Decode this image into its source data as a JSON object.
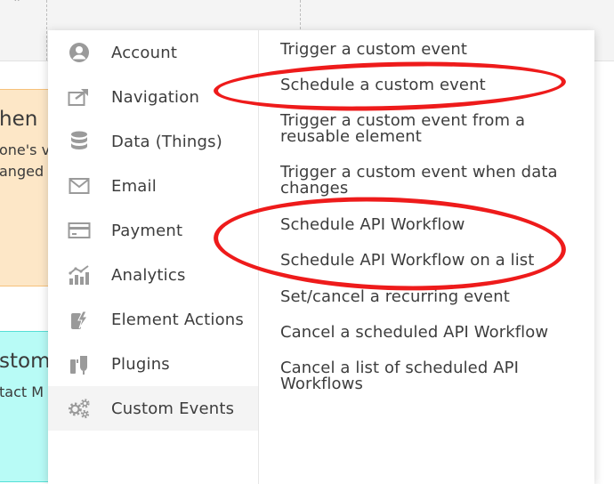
{
  "background_cards": {
    "orange": {
      "title": "hen",
      "lines": [
        "one's v",
        "anged"
      ]
    },
    "cyan": {
      "title": "stom",
      "lines": [
        "tact M"
      ]
    }
  },
  "menu": {
    "categories": [
      {
        "label": "Account",
        "icon": "account-icon"
      },
      {
        "label": "Navigation",
        "icon": "navigation-icon"
      },
      {
        "label": "Data (Things)",
        "icon": "database-icon"
      },
      {
        "label": "Email",
        "icon": "email-icon"
      },
      {
        "label": "Payment",
        "icon": "payment-icon"
      },
      {
        "label": "Analytics",
        "icon": "analytics-icon"
      },
      {
        "label": "Element Actions",
        "icon": "element-actions-icon"
      },
      {
        "label": "Plugins",
        "icon": "plugins-icon"
      },
      {
        "label": "Custom Events",
        "icon": "gears-icon",
        "selected": true
      }
    ],
    "actions": [
      {
        "text": "Trigger a custom event"
      },
      {
        "text": "Schedule a custom event",
        "annotated": true
      },
      {
        "text": "Trigger a custom event from a reusable element"
      },
      {
        "text": "Trigger a custom event when data changes"
      },
      {
        "text": "Schedule API Workflow",
        "annotated": true
      },
      {
        "text": "Schedule API Workflow on a list",
        "annotated": true
      },
      {
        "text": "Set/cancel a recurring event"
      },
      {
        "text": "Cancel a scheduled API Workflow"
      },
      {
        "text": "Cancel a list of scheduled API Workflows"
      }
    ]
  },
  "colors": {
    "annotation": "#ee1b1b",
    "icon_gray": "#9a9a9a",
    "selected_bg": "#f4f4f4",
    "orange_card": "#fde7c7",
    "cyan_card": "#b8fbf6"
  }
}
